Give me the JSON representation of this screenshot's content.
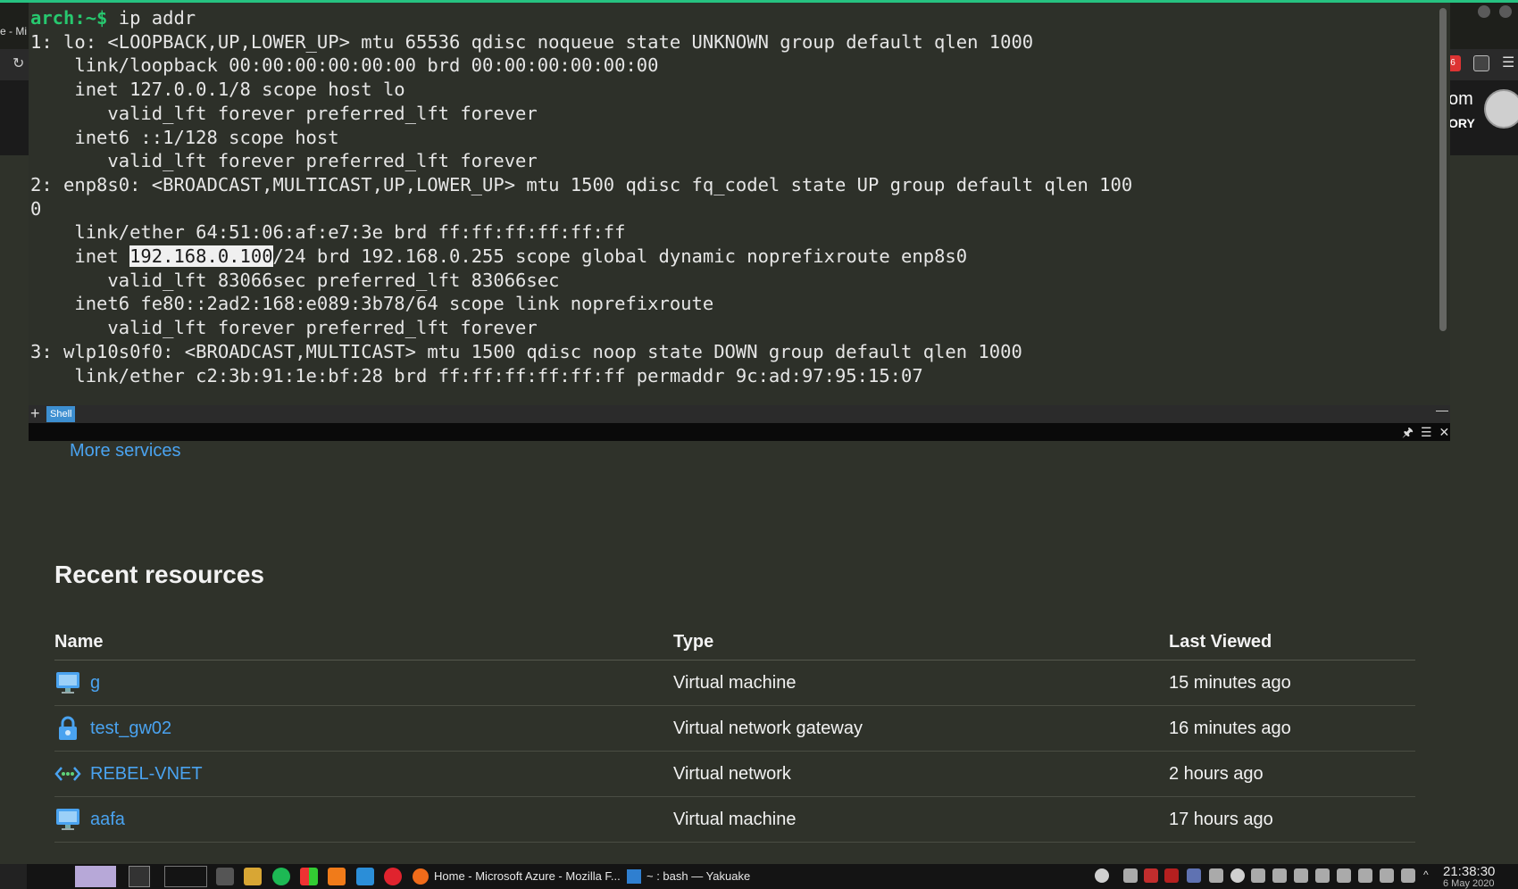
{
  "browser": {
    "tab_fragment": "e - Mi",
    "account_name": "om",
    "account_dir": "ORY",
    "badge": "6"
  },
  "terminal": {
    "prompt_host": "arch:~$",
    "command": " ip addr",
    "lines": [
      "1: lo: <LOOPBACK,UP,LOWER_UP> mtu 65536 qdisc noqueue state UNKNOWN group default qlen 1000",
      "    link/loopback 00:00:00:00:00:00 brd 00:00:00:00:00:00",
      "    inet 127.0.0.1/8 scope host lo",
      "       valid_lft forever preferred_lft forever",
      "    inet6 ::1/128 scope host",
      "       valid_lft forever preferred_lft forever",
      "2: enp8s0: <BROADCAST,MULTICAST,UP,LOWER_UP> mtu 1500 qdisc fq_codel state UP group default qlen 100",
      "0",
      "    link/ether 64:51:06:af:e7:3e brd ff:ff:ff:ff:ff:ff"
    ],
    "inet_prefix": "    inet ",
    "inet_highlight": "192.168.0.100",
    "inet_suffix": "/24 brd 192.168.0.255 scope global dynamic noprefixroute enp8s0",
    "lines_after": [
      "       valid_lft 83066sec preferred_lft 83066sec",
      "    inet6 fe80::2ad2:168:e089:3b78/64 scope link noprefixroute",
      "       valid_lft forever preferred_lft forever",
      "3: wlp10s0f0: <BROADCAST,MULTICAST> mtu 1500 qdisc noop state DOWN group default qlen 1000",
      "    link/ether c2:3b:91:1e:bf:28 brd ff:ff:ff:ff:ff:ff permaddr 9c:ad:97:95:15:07"
    ],
    "tab_label": "Shell"
  },
  "portal": {
    "more_services": "More services",
    "recent_title": "Recent resources",
    "columns": {
      "name": "Name",
      "type": "Type",
      "last": "Last Viewed"
    },
    "rows": [
      {
        "name": "g",
        "type": "Virtual machine",
        "last": "15 minutes ago",
        "icon": "vm-icon"
      },
      {
        "name": "test_gw02",
        "type": "Virtual network gateway",
        "last": "16 minutes ago",
        "icon": "gateway-lock-icon"
      },
      {
        "name": "REBEL-VNET",
        "type": "Virtual network",
        "last": "2 hours ago",
        "icon": "vnet-icon"
      },
      {
        "name": "aafa",
        "type": "Virtual machine",
        "last": "17 hours ago",
        "icon": "vm-icon"
      }
    ]
  },
  "taskbar": {
    "task_firefox": "Home - Microsoft Azure - Mozilla F...",
    "task_yakuake": "~ : bash — Yakuake",
    "clock_time": "21:38:30",
    "clock_date": "6 May 2020"
  },
  "colors": {
    "accent": "#26c281",
    "link": "#4aa3f0",
    "prompt": "#27c86f"
  }
}
